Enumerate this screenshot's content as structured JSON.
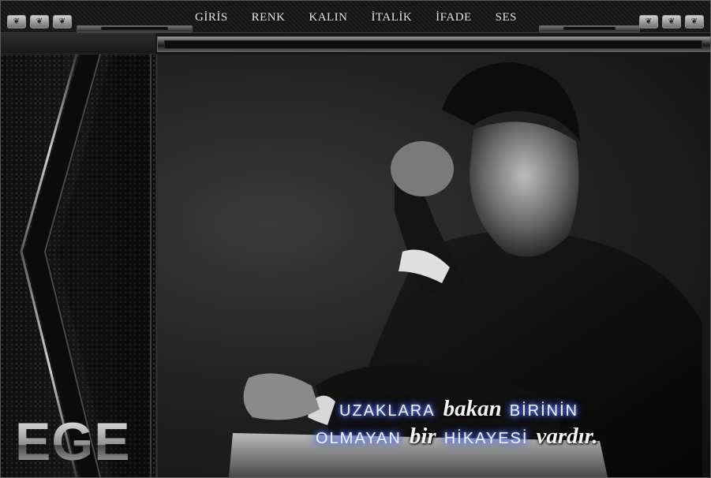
{
  "menu": {
    "items": [
      {
        "id": "giris",
        "label": "GİRİS"
      },
      {
        "id": "renk",
        "label": "RENK"
      },
      {
        "id": "kalin",
        "label": "KALIN"
      },
      {
        "id": "italik",
        "label": "İTALİK"
      },
      {
        "id": "ifade",
        "label": "İFADE"
      },
      {
        "id": "ses",
        "label": "SES"
      }
    ]
  },
  "window_controls": {
    "icon_names": [
      "ornament-icon",
      "ornament-icon",
      "ornament-icon"
    ]
  },
  "sidebar": {
    "logo_text": "EGE"
  },
  "quote": {
    "line1": [
      "UZAKLARA",
      "bakan",
      "BİRİNİN"
    ],
    "line2": [
      "OLMAYAN",
      "bir",
      "HİKAYESİ",
      "vardır."
    ]
  },
  "colors": {
    "glow": "#4a6cff",
    "chrome": "#cfcfcf",
    "background": "#101010"
  }
}
